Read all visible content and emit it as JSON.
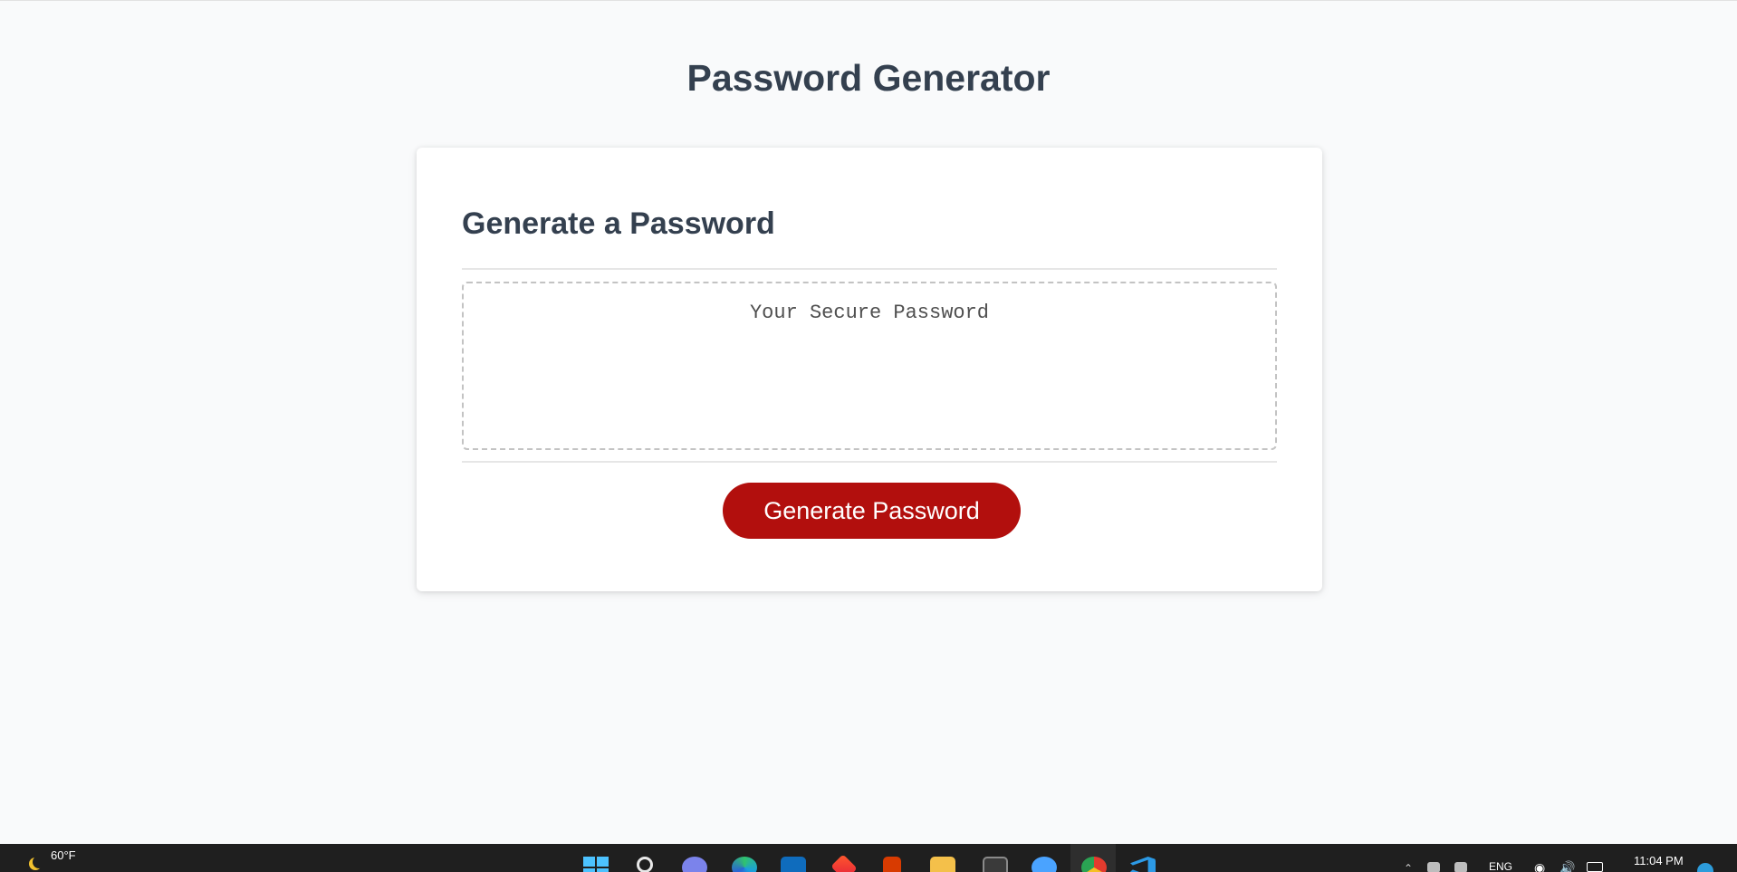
{
  "header": {
    "title": "Password Generator"
  },
  "card": {
    "title": "Generate a Password",
    "password": {
      "placeholder": "Your Secure Password",
      "value": ""
    },
    "generate_button_label": "Generate Password",
    "accent_color": "#b20f0d"
  },
  "taskbar": {
    "weather": {
      "temperature": "60°F",
      "icon": "moon-icon"
    },
    "pinned_apps": [
      "windows-start-icon",
      "search-icon",
      "teams-icon",
      "edge-icon",
      "mail-icon",
      "app-icon",
      "office-icon",
      "file-explorer-icon",
      "app-icon",
      "app-icon",
      "chrome-icon",
      "vscode-icon"
    ],
    "tray": {
      "language": "ENG",
      "time": "11:04 PM"
    }
  }
}
